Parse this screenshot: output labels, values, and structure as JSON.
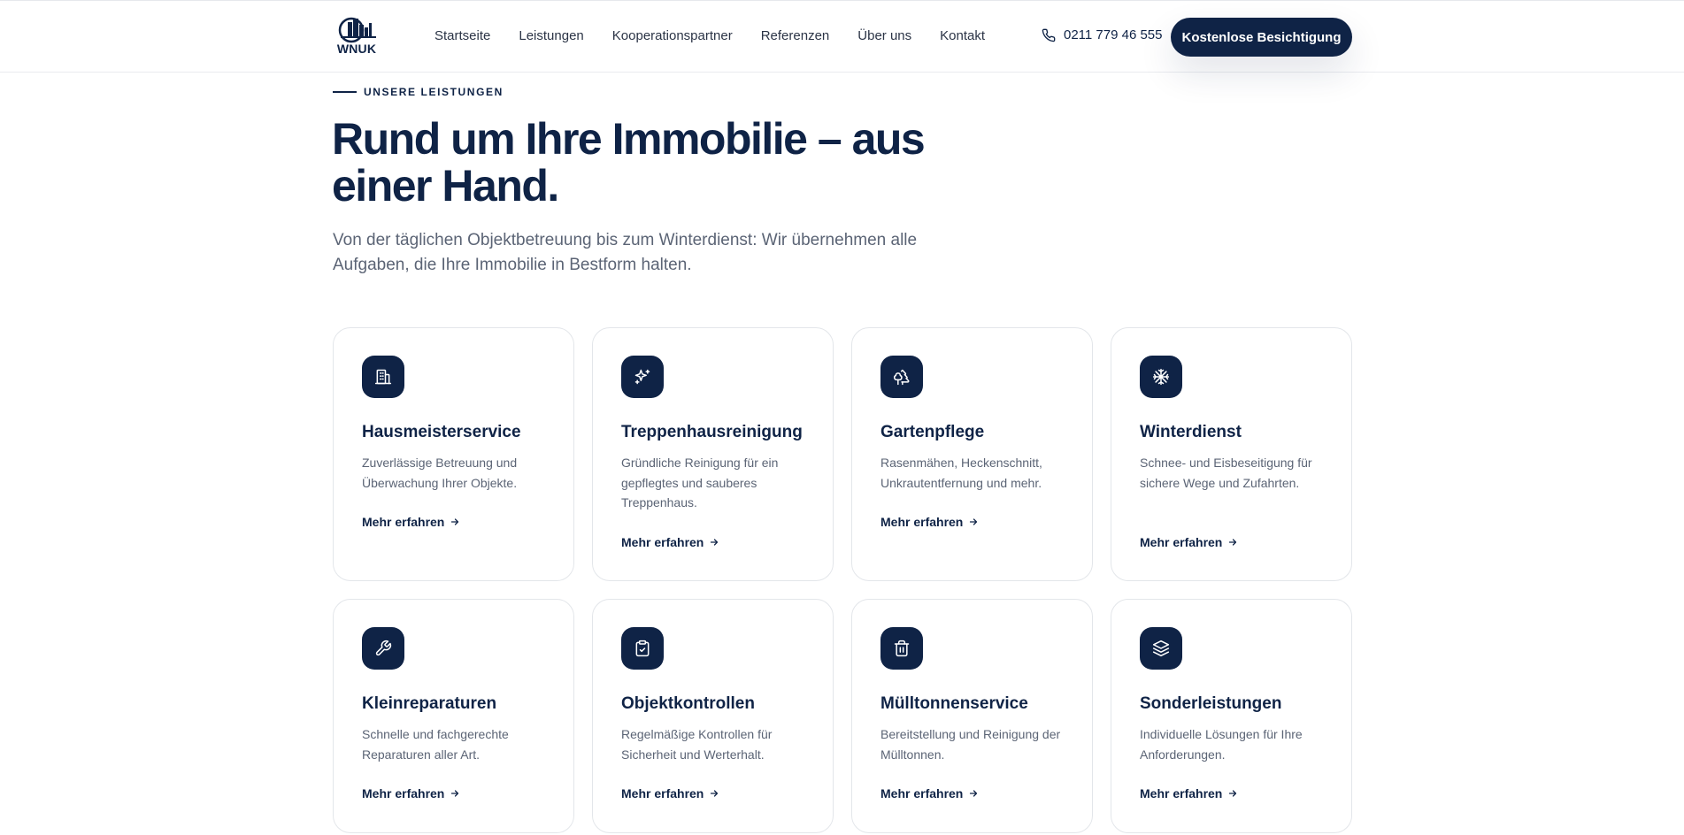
{
  "header": {
    "logo_text": "WNUK",
    "nav": [
      "Startseite",
      "Leistungen",
      "Kooperationspartner",
      "Referenzen",
      "Über uns",
      "Kontakt"
    ],
    "phone": "0211 779 46 555",
    "cta_label": "Kostenlose Besichtigung"
  },
  "hero": {
    "eyebrow": "UNSERE LEISTUNGEN",
    "title": "Rund um Ihre Immobilie – aus einer Hand.",
    "subtitle": "Von der täglichen Objektbetreuung bis zum Winterdienst: Wir übernehmen alle Aufgaben, die Ihre Immobilie in Bestform halten."
  },
  "services": [
    {
      "icon": "building-icon",
      "title": "Hausmeisterservice",
      "text": "Zuverlässige Betreuung und Überwachung Ihrer Objekte.",
      "link": "Mehr erfahren"
    },
    {
      "icon": "sparkles-icon",
      "title": "Treppenhausreinigung",
      "text": "Gründliche Reinigung für ein gepflegtes und sauberes Treppenhaus.",
      "link": "Mehr erfahren"
    },
    {
      "icon": "tree-icon",
      "title": "Gartenpflege",
      "text": "Rasenmähen, Heckenschnitt, Unkrautentfernung und mehr.",
      "link": "Mehr erfahren"
    },
    {
      "icon": "snowflake-icon",
      "title": "Winterdienst",
      "text": "Schnee- und Eisbeseitigung für sichere Wege und Zufahrten.",
      "link": "Mehr erfahren"
    },
    {
      "icon": "wrench-icon",
      "title": "Kleinreparaturen",
      "text": "Schnelle und fachgerechte Reparaturen aller Art.",
      "link": "Mehr erfahren"
    },
    {
      "icon": "clipboard-check-icon",
      "title": "Objektkontrollen",
      "text": "Regelmäßige Kontrollen für Sicherheit und Werterhalt.",
      "link": "Mehr erfahren"
    },
    {
      "icon": "trash-icon",
      "title": "Mülltonnenservice",
      "text": "Bereitstellung und Reinigung der Mülltonnen.",
      "link": "Mehr erfahren"
    },
    {
      "icon": "layers-icon",
      "title": "Sonderleistungen",
      "text": "Individuelle Lösungen für Ihre Anforderungen.",
      "link": "Mehr erfahren"
    }
  ],
  "colors": {
    "primary": "#0f2346",
    "text_muted": "#5b6475",
    "border": "#e3e6ea"
  }
}
